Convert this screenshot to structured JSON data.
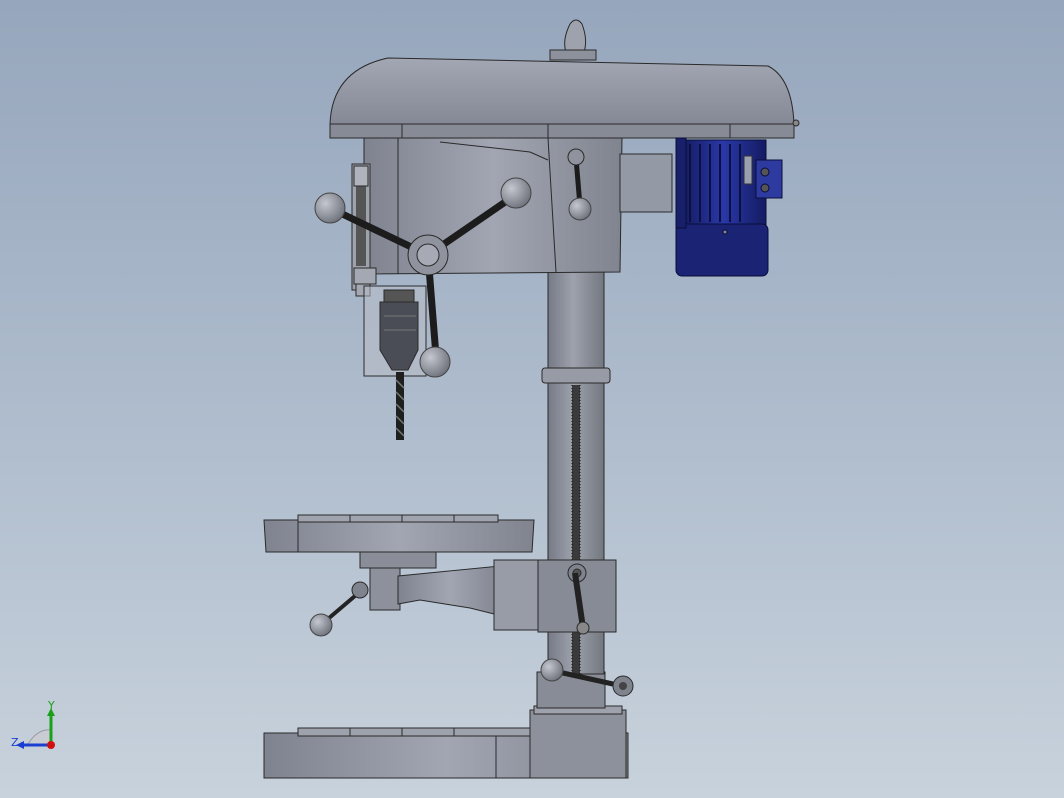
{
  "view": {
    "triad": {
      "y_label": "Y",
      "z_label": "Z"
    },
    "colors": {
      "background_top": "#96a6bc",
      "background_bottom": "#c8d2dc",
      "machine_body": "#8e929e",
      "machine_shadow": "#6d717d",
      "motor_blue": "#1e2a8a",
      "outline": "#2a2a2a",
      "axis_y": "#1aa01a",
      "axis_x": "#d01010",
      "axis_z": "#1a3fd0"
    }
  }
}
